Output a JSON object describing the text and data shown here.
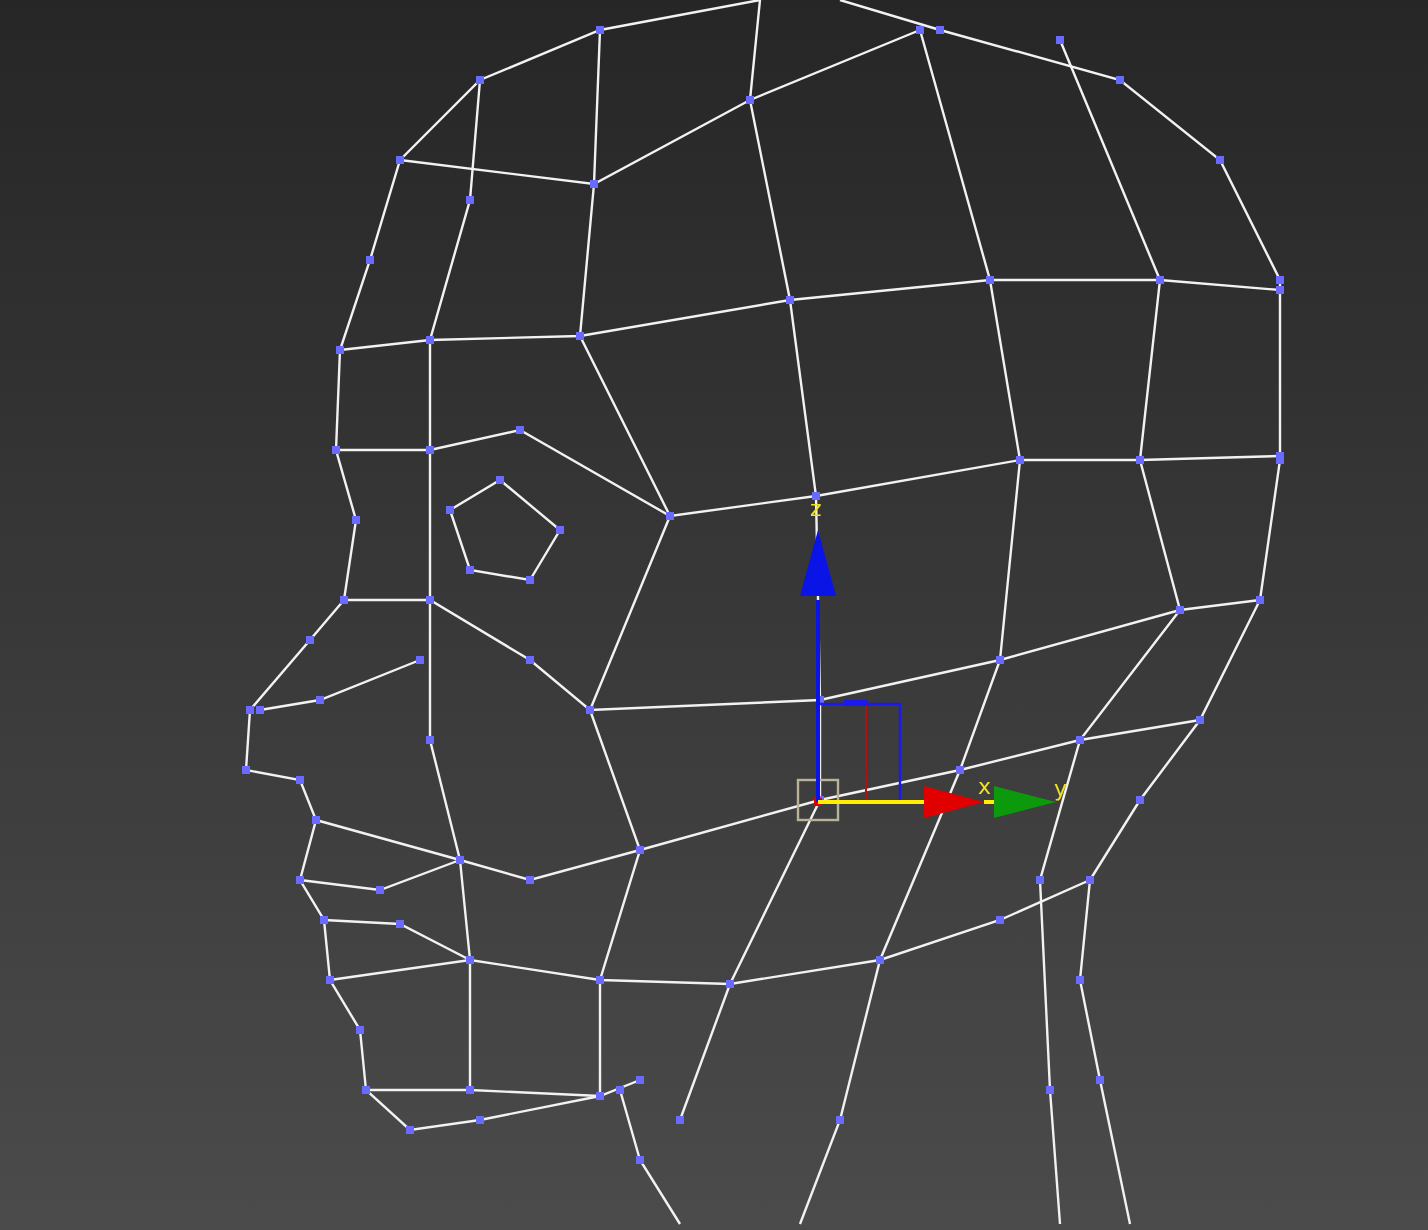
{
  "viewport": {
    "gizmo": {
      "axes": [
        {
          "label": "z",
          "color": "#0a14e6"
        },
        {
          "label": "x",
          "color": "#e00000"
        },
        {
          "label": "y",
          "color": "#0c9a0c"
        }
      ]
    }
  }
}
